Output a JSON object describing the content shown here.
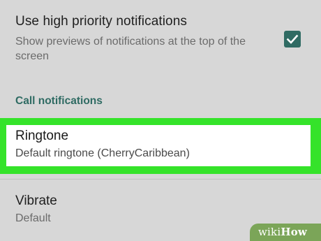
{
  "high_priority": {
    "title": "Use high priority notifications",
    "summary": "Show previews of notifications at the top of the screen",
    "checked": true
  },
  "call_notifications": {
    "category_label": "Call notifications"
  },
  "ringtone": {
    "title": "Ringtone",
    "summary": "Default ringtone (CherryCaribbean)"
  },
  "vibrate": {
    "title": "Vibrate",
    "summary": "Default"
  },
  "watermark": {
    "wiki": "wiki",
    "how": "How"
  },
  "colors": {
    "background": "#d7d7d7",
    "accent": "#2f6b63",
    "highlight": "#35e32a",
    "watermark": "#7ba558"
  }
}
